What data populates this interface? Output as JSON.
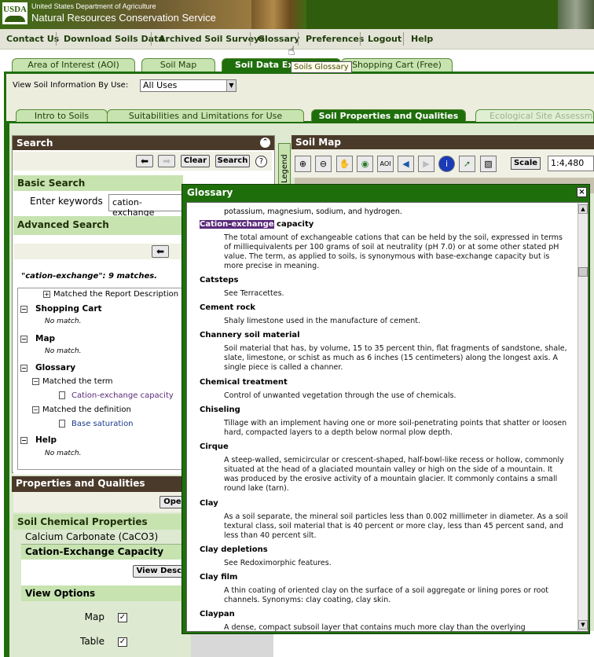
{
  "header": {
    "logo": "USDA",
    "department": "United States Department of Agriculture",
    "agency": "Natural Resources Conservation Service"
  },
  "topnav": [
    "Contact Us",
    "Download Soils Data",
    "Archived Soil Surveys",
    "Glossary",
    "Preferences",
    "Logout",
    "Help"
  ],
  "tooltip": "Soils Glossary",
  "main_tabs": [
    "Area of Interest (AOI)",
    "Soil Map",
    "Soil Data Ex",
    "Shopping Cart (Free)"
  ],
  "view_by_use": {
    "label": "View Soil Information By Use:",
    "value": "All Uses"
  },
  "sub_tabs": [
    "Intro to Soils",
    "Suitabilities and Limitations for Use",
    "Soil Properties and Qualities",
    "Ecological Site Assessm"
  ],
  "search": {
    "title": "Search",
    "clear": "Clear",
    "search": "Search",
    "basic": "Basic Search",
    "keywords_label": "Enter keywords",
    "keywords_value": "cation-exchange",
    "advanced": "Advanced Search",
    "matches": "\"cation-exchange\": 9 matches.",
    "tree": {
      "report": "Matched the Report Description",
      "cart": "Shopping Cart",
      "cart_none": "No match.",
      "map": "Map",
      "map_none": "No match.",
      "glossary": "Glossary",
      "term": "Matched the term",
      "term_link": "Cation-exchange capacity",
      "definition": "Matched the definition",
      "definition_link": "Base saturation",
      "help": "Help",
      "help_none": "No match."
    }
  },
  "props": {
    "title": "Properties and Qualities Ratings",
    "open": "Open",
    "chem": "Soil Chemical Properties",
    "calc": "Calcium Carbonate (CaCO3)",
    "cec": "Cation-Exchange Capacity (CEC",
    "view_desc": "View Descri",
    "view_options": "View Options",
    "map_label": "Map",
    "table_label": "Table"
  },
  "soil_map": {
    "title": "Soil Map",
    "legend": "Legend",
    "scale_btn": "Scale",
    "scale_value": "1:4,480",
    "aoi": "AOI"
  },
  "glossary": {
    "title": "Glossary",
    "close": "×",
    "top_fragment": "potassium, magnesium, sodium, and hydrogen.",
    "entries": [
      {
        "term_hl": "Cation-exchange",
        "term": " capacity",
        "def": "The total amount of exchangeable cations that can be held by the soil, expressed in terms of milliequivalents per 100 grams of soil at neutrality (pH 7.0) or at some other stated pH value. The term, as applied to soils, is synonymous with base-exchange capacity but is more precise in meaning."
      },
      {
        "term": "Catsteps",
        "def": "See Terracettes."
      },
      {
        "term": "Cement rock",
        "def": "Shaly limestone used in the manufacture of cement."
      },
      {
        "term": "Channery soil material",
        "def": "Soil material that has, by volume, 15 to 35 percent thin, flat fragments of sandstone, shale, slate, limestone, or schist as much as 6 inches (15 centimeters) along the longest axis. A single piece is called a channer."
      },
      {
        "term": "Chemical treatment",
        "def": "Control of unwanted vegetation through the use of chemicals."
      },
      {
        "term": "Chiseling",
        "def": "Tillage with an implement having one or more soil-penetrating points that shatter or loosen hard, compacted layers to a depth below normal plow depth."
      },
      {
        "term": "Cirque",
        "def": "A steep-walled, semicircular or crescent-shaped, half-bowl-like recess or hollow, commonly situated at the head of a glaciated mountain valley or high on the side of a mountain. It was produced by the erosive activity of a mountain glacier. It commonly contains a small round lake (tarn)."
      },
      {
        "term": "Clay",
        "def": "As a soil separate, the mineral soil particles less than 0.002 millimeter in diameter. As a soil textural class, soil material that is 40 percent or more clay, less than 45 percent sand, and less than 40 percent silt."
      },
      {
        "term": "Clay depletions",
        "def": "See Redoximorphic features."
      },
      {
        "term": "Clay film",
        "def": "A thin coating of oriented clay on the surface of a soil aggregate or lining pores or root channels. Synonyms: clay coating, clay skin."
      },
      {
        "term": "Claypan",
        "def": "A dense, compact subsoil layer that contains much more clay than the overlying"
      }
    ]
  }
}
